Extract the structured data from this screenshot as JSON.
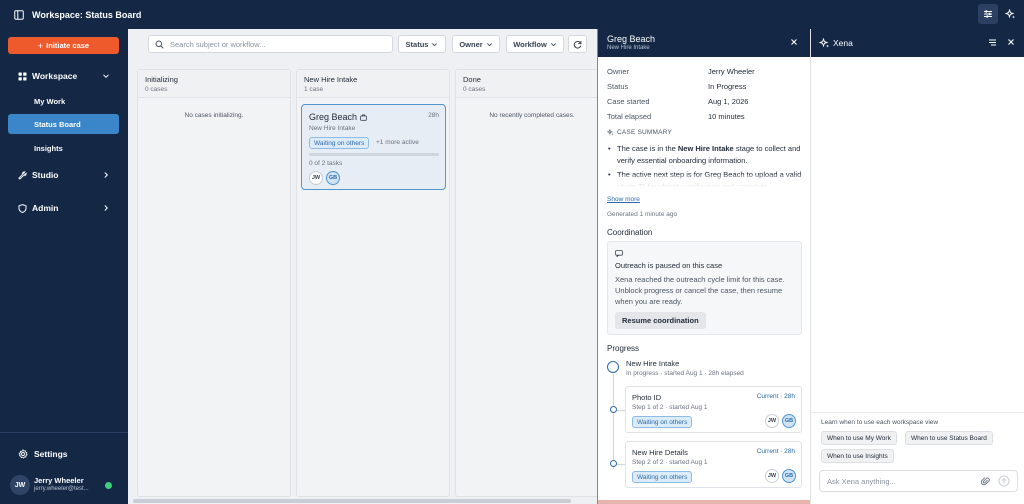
{
  "app": {
    "title": "Workspace: Status Board"
  },
  "colors": {
    "navy": "#142846",
    "accent_orange": "#ee5a2b",
    "accent_blue": "#3a86c8",
    "online_green": "#3bcf7a"
  },
  "sidebar": {
    "initiate_label": "Initiate case",
    "workspace_label": "Workspace",
    "sub_items": [
      {
        "label": "My Work"
      },
      {
        "label": "Status Board",
        "active": true
      },
      {
        "label": "Insights"
      }
    ],
    "studio_label": "Studio",
    "admin_label": "Admin",
    "settings_label": "Settings",
    "user": {
      "initials": "JW",
      "name": "Jerry Wheeler",
      "email": "jerry.wheeler@test...",
      "status": "online"
    }
  },
  "toolbar": {
    "search_placeholder": "Search subject or workflow...",
    "filters": {
      "status": "Status",
      "owner": "Owner",
      "workflow": "Workflow"
    }
  },
  "board": {
    "columns": [
      {
        "title": "Initializing",
        "count": "0 cases",
        "empty": "No cases initializing."
      },
      {
        "title": "New Hire Intake",
        "count": "1 case",
        "empty": ""
      },
      {
        "title": "Done",
        "count": "0 cases",
        "empty": "No recently completed cases."
      }
    ],
    "card": {
      "name": "Greg Beach",
      "age": "28h",
      "stage": "New Hire Intake",
      "badge": "Waiting on others",
      "more": "+1 more active",
      "progress": 0,
      "tasks": "0 of 2 tasks",
      "avatars": [
        "JW",
        "GB"
      ]
    }
  },
  "detail": {
    "name": "Greg Beach",
    "subtitle": "New Hire Intake",
    "fields": [
      {
        "label": "Owner",
        "value": "Jerry Wheeler"
      },
      {
        "label": "Status",
        "value": "In Progress"
      },
      {
        "label": "Case started",
        "value": "Aug 1, 2026"
      },
      {
        "label": "Total elapsed",
        "value": "10 minutes"
      }
    ],
    "summary_heading": "CASE SUMMARY",
    "summary": {
      "b1_pre": "The case is in the ",
      "b1_bold": "New Hire Intake",
      "b1_post": " stage to collect and verify essential onboarding information.",
      "b2": "The active next step is for Greg Beach to upload a valid photo ID for identity verification and complete"
    },
    "show_more": "Show more",
    "generated": "Generated 1 minute ago",
    "coordination": {
      "title": "Coordination",
      "paused_title": "Outreach is paused on this case",
      "description": "Xena reached the outreach cycle limit for this case. Unblock progress or cancel the case, then resume when you are ready.",
      "resume_label": "Resume coordination"
    },
    "progress": {
      "title": "Progress",
      "stage_name": "New Hire Intake",
      "stage_sub": "In progress · started Aug 1 · 28h elapsed",
      "steps": [
        {
          "name": "Photo ID",
          "current": "Current · 28h",
          "sub": "Step 1 of 2 · started Aug 1",
          "badge": "Waiting on others",
          "avatars": [
            "JW",
            "GB"
          ]
        },
        {
          "name": "New Hire Details",
          "current": "Current · 28h",
          "sub": "Step 2 of 2 · started Aug 1",
          "badge": "Waiting on others",
          "avatars": [
            "JW",
            "GB"
          ]
        }
      ]
    }
  },
  "xena": {
    "title": "Xena",
    "learn_label": "Learn when to use each workspace view",
    "chips": [
      "When to use My Work",
      "When to use Status Board",
      "When to use Insights"
    ],
    "ask_placeholder": "Ask Xena anything..."
  }
}
